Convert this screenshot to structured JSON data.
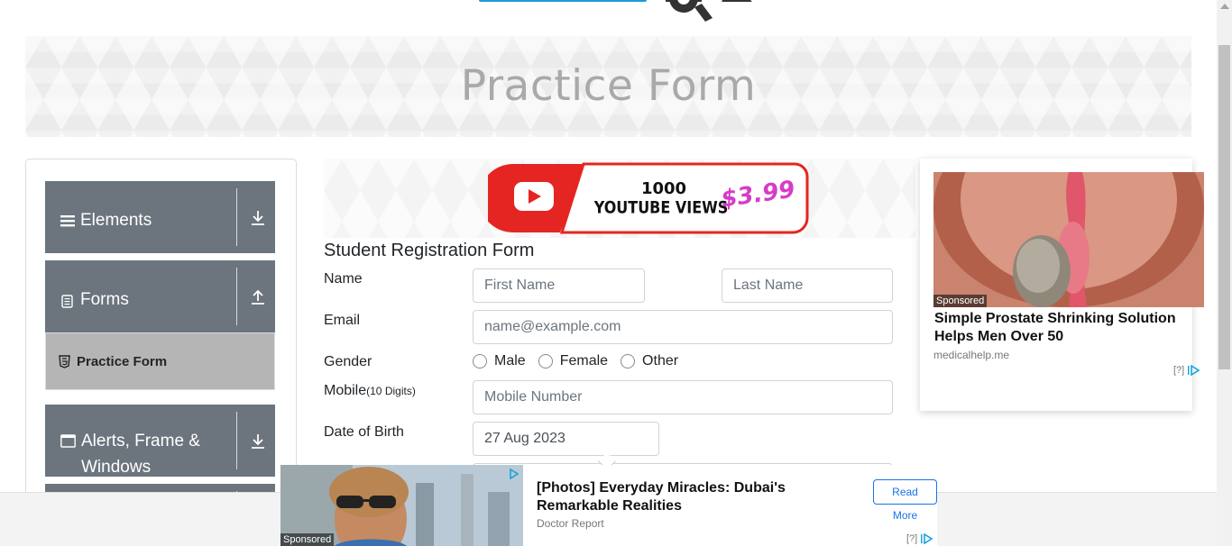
{
  "banner": {
    "title": "Practice Form"
  },
  "sidebar": {
    "groups": [
      {
        "label": "Elements",
        "icon": "list-icon",
        "arrow": "download-arrow-icon"
      },
      {
        "label": "Forms",
        "icon": "document-icon",
        "arrow": "upload-arrow-icon"
      },
      {
        "label": "Alerts, Frame & Windows",
        "icon": "window-icon",
        "arrow": "download-arrow-icon"
      }
    ],
    "active_item": {
      "label": "Practice Form",
      "icon": "html5-icon"
    }
  },
  "promo": {
    "count": "1000",
    "text": "YOUTUBE VIEWS",
    "price": "$3.99"
  },
  "form": {
    "title": "Student Registration Form",
    "name_label": "Name",
    "first_name_placeholder": "First Name",
    "last_name_placeholder": "Last Name",
    "email_label": "Email",
    "email_placeholder": "name@example.com",
    "gender_label": "Gender",
    "gender_options": [
      "Male",
      "Female",
      "Other"
    ],
    "mobile_label": "Mobile",
    "mobile_hint": "(10 Digits)",
    "mobile_placeholder": "Mobile Number",
    "dob_label": "Date of Birth",
    "dob_value": "27 Aug 2023"
  },
  "ad_right": {
    "sponsored": "Sponsored",
    "title": "Simple Prostate Shrinking Solution Helps Men Over 50",
    "source": "medicalhelp.me",
    "info": "[?]"
  },
  "ad_bottom": {
    "sponsored": "Sponsored",
    "title": "[Photos] Everyday Miracles: Dubai's Remarkable Realities",
    "source": "Doctor Report",
    "cta": "Read More",
    "info": "[?]"
  },
  "colors": {
    "sidebar_group": "#6c757d",
    "active_item": "#b5b5b5",
    "accent": "#1a73e8",
    "promo_red": "#e52521"
  }
}
